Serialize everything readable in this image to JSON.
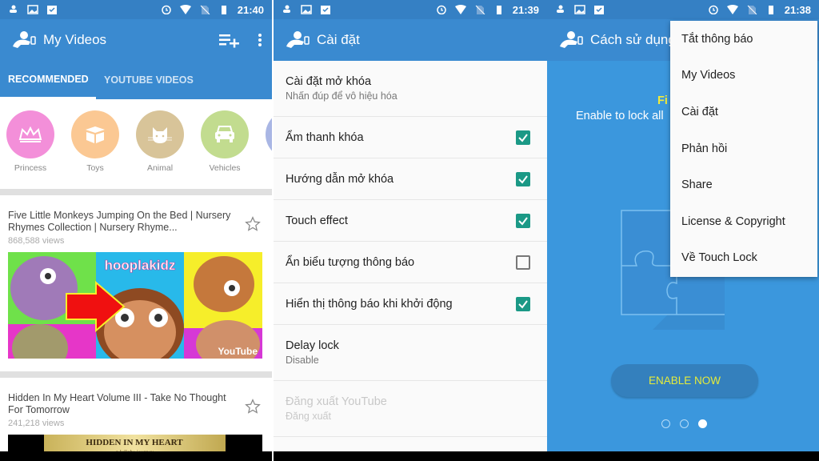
{
  "screen1": {
    "status": {
      "time": "21:40"
    },
    "appbar": {
      "title": "My Videos",
      "icons": [
        "playlist-add-icon",
        "more-vert-icon"
      ]
    },
    "tabs": [
      {
        "label": "RECOMMENDED",
        "active": true
      },
      {
        "label": "YOUTUBE VIDEOS",
        "active": false
      }
    ],
    "categories": [
      {
        "label": "Princess",
        "color": "#f38fd9",
        "icon": "crown-icon"
      },
      {
        "label": "Toys",
        "color": "#fbc893",
        "icon": "box-icon"
      },
      {
        "label": "Animal",
        "color": "#d8c499",
        "icon": "cat-icon"
      },
      {
        "label": "Vehicles",
        "color": "#c2dc8f",
        "icon": "car-icon"
      }
    ],
    "videos": [
      {
        "title": "Five Little Monkeys Jumping On the Bed | Nursery Rhymes Collection | Nursery Rhyme...",
        "views": "868,588 views",
        "thumb_text": "hooplakidz",
        "watermark": "YouTube"
      },
      {
        "title": "Hidden In My Heart Volume III - Take No Thought For Tomorrow",
        "views": "241,218 views",
        "thumb_text": "HIDDEN IN MY HEART",
        "thumb_sub": "a lullaby journey"
      }
    ]
  },
  "screen2": {
    "status": {
      "time": "21:39"
    },
    "appbar": {
      "title": "Cài đặt"
    },
    "items": [
      {
        "title": "Cài đặt mở khóa",
        "sub": "Nhấn đúp để vô hiệu hóa"
      },
      {
        "title": "Ẩm thanh khóa",
        "checked": true
      },
      {
        "title": "Hướng dẫn mở khóa",
        "checked": true
      },
      {
        "title": "Touch effect",
        "checked": true
      },
      {
        "title": "Ẩn biểu tượng thông báo",
        "checked": false
      },
      {
        "title": "Hiển thị thông báo khi khởi động",
        "checked": true
      },
      {
        "title": "Delay lock",
        "sub": "Disable"
      },
      {
        "title": "Đăng xuất YouTube",
        "sub": "Đăng xuất",
        "disabled": true
      }
    ]
  },
  "screen3": {
    "status": {
      "time": "21:38"
    },
    "appbar": {
      "title": "Cách sử dụng"
    },
    "heading_partial": "Fi",
    "subtitle": "Enable to lock all",
    "enable_button": "ENABLE NOW",
    "page_indicator": {
      "total": 3,
      "current": 3
    },
    "menu": [
      "Tắt thông báo",
      "My Videos",
      "Cài đặt",
      "Phản hồi",
      "Share",
      "License & Copyright",
      "Về Touch Lock"
    ]
  }
}
